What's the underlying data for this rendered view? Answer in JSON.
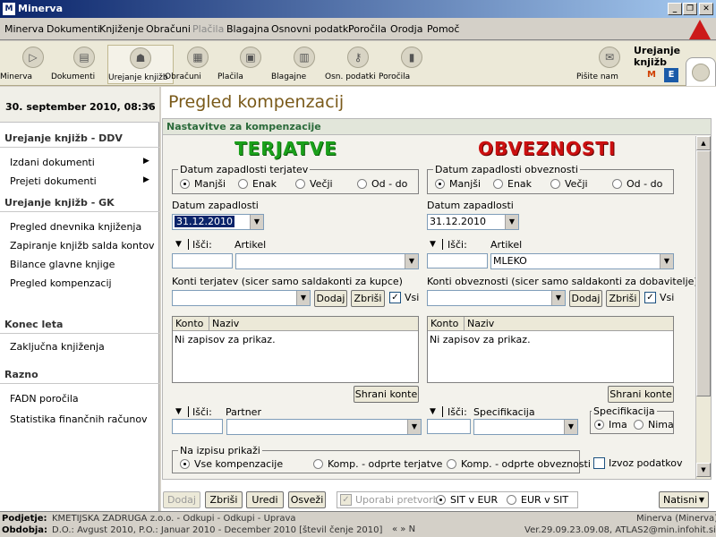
{
  "window": {
    "title": "Minerva"
  },
  "menu": [
    "Minerva",
    "Dokumenti",
    "Knjiženje",
    "Obračuni",
    "Plačila",
    "Blagajna",
    "Osnovni podatki",
    "Poročila",
    "Orodja",
    "Pomoč"
  ],
  "toolbar": {
    "buttons": [
      "Minerva",
      "Dokumenti",
      "Urejanje knjižb",
      "Obračuni",
      "Plačila",
      "Blagajne",
      "Osn. podatki",
      "Poročila",
      "Pišite nam"
    ],
    "active_title": "Urejanje knjižb"
  },
  "nav": {
    "datetime": "30. september 2010, 08:36",
    "sections": [
      {
        "title": "Urejanje knjižb - DDV",
        "items": [
          "Izdani dokumenti",
          "Prejeti dokumenti"
        ]
      },
      {
        "title": "Urejanje knjižb - GK",
        "items": [
          "Pregled dnevnika knjiženja",
          "Zapiranje knjižb salda kontov",
          "Bilance glavne knjige",
          "Pregled kompenzacij"
        ]
      },
      {
        "title": "Konec leta",
        "items": [
          "Zaključna knjiženja"
        ]
      },
      {
        "title": "Razno",
        "items": [
          "FADN poročila",
          "Statistika finančnih računov"
        ]
      }
    ]
  },
  "page": {
    "title": "Pregled kompenzacij",
    "panel_title": "Nastavitve za kompenzacije"
  },
  "left": {
    "heading": "TERJATVE",
    "date_group": "Datum zapadlosti terjatev",
    "date_label": "Datum zapadlosti",
    "date_value": "31.12.2010",
    "search_label": "Išči:",
    "article_label": "Artikel",
    "article_value": "",
    "konti_label": "Konti terjatev (sicer samo saldakonti za kupce)",
    "grid_cols": [
      "Konto",
      "Naziv"
    ],
    "grid_empty": "Ni zapisov za prikaz.",
    "save_konti": "Shrani konte",
    "partner_label": "Partner"
  },
  "right": {
    "heading": "OBVEZNOSTI",
    "date_group": "Datum zapadlosti obveznosti",
    "date_label": "Datum zapadlosti",
    "date_value": "31.12.2010",
    "search_label": "Išči:",
    "article_label": "Artikel",
    "article_value": "MLEKO",
    "konti_label": "Konti obveznosti (sicer samo saldakonti za dobavitelje):",
    "grid_cols": [
      "Konto",
      "Naziv"
    ],
    "grid_empty": "Ni zapisov za prikaz.",
    "save_konti": "Shrani konte",
    "spec_label": "Specifikacija",
    "spec_group": "Specifikacija",
    "spec_options": [
      "Ima",
      "Nima"
    ]
  },
  "compare_options": [
    "Manjši",
    "Enak",
    "Večji",
    "Od - do"
  ],
  "common": {
    "add": "Dodaj",
    "delete": "Zbriši",
    "all": "Vsi"
  },
  "print_group": {
    "title": "Na izpisu prikaži",
    "options": [
      "Vse kompenzacije",
      "Komp. - odprte terjatve",
      "Komp. - odprte obveznosti"
    ]
  },
  "export_label": "Izvoz podatkov",
  "actions": {
    "add": "Dodaj",
    "delete": "Zbriši",
    "edit": "Uredi",
    "refresh": "Osveži",
    "use_conversion": "Uporabi pretvorbo",
    "sit_eur": "SIT v EUR",
    "eur_sit": "EUR v SIT",
    "print": "Natisni"
  },
  "status": {
    "company_key": "Podjetje:",
    "company_val": "KMETIJSKA ZADRUGA z.o.o. - Odkupi - Odkupi - Uprava",
    "app_right": "Minerva (Minerva)",
    "period_key": "Obdobja:",
    "period_val": "D.O.: Avgust 2010, P.O.: Januar 2010 - December 2010 [števil čenje 2010]",
    "nav_controls": "«  »  N",
    "version": "Ver.29.09.23.09.08, ATLAS2@min.infohit.si"
  }
}
